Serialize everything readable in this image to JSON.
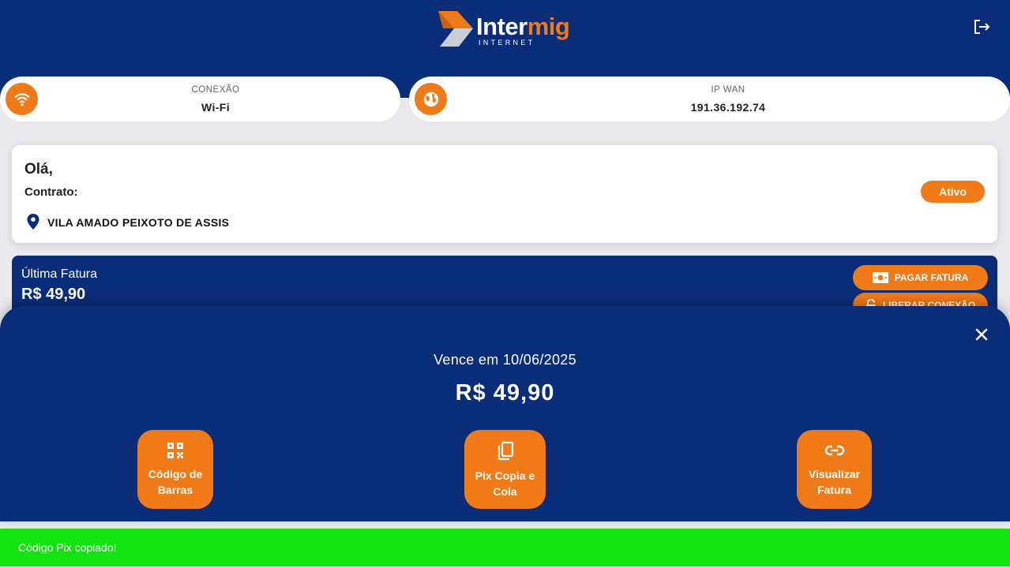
{
  "header": {
    "logo_text_main": "Inter",
    "logo_text_accent": "mig",
    "logo_subtext": "INTERNET",
    "logout_icon": "logout-icon"
  },
  "connection": {
    "caption": "CONEXÃO",
    "value": "Wi-Fi",
    "icon": "wifi-icon"
  },
  "wan": {
    "caption": "IP WAN",
    "value": "191.36.192.74",
    "icon": "globe-icon"
  },
  "client": {
    "greeting": "Olá,",
    "contract_label": "Contrato:",
    "status": "Ativo",
    "address": "VILA AMADO PEIXOTO DE ASSIS",
    "address_icon": "location-pin-icon"
  },
  "invoice": {
    "title": "Última Fatura",
    "amount": "R$ 49,90",
    "pay_label": "PAGAR FATURA",
    "release_label": "LIBERAR CONEXÃO"
  },
  "sheet": {
    "due_text": "Vence em 10/06/2025",
    "amount": "R$ 49,90",
    "actions": [
      {
        "label": "Código de Barras",
        "icon": "qr-code-icon"
      },
      {
        "label": "Pix Copia e Cola",
        "icon": "copy-icon"
      },
      {
        "label": "Visualizar Fatura",
        "icon": "link-icon"
      }
    ]
  },
  "toast": {
    "message": "Código Pix copiado!"
  },
  "colors": {
    "brand_blue": "#0a2d7a",
    "accent_orange": "#f07a18",
    "toast_green": "#12e30f"
  }
}
